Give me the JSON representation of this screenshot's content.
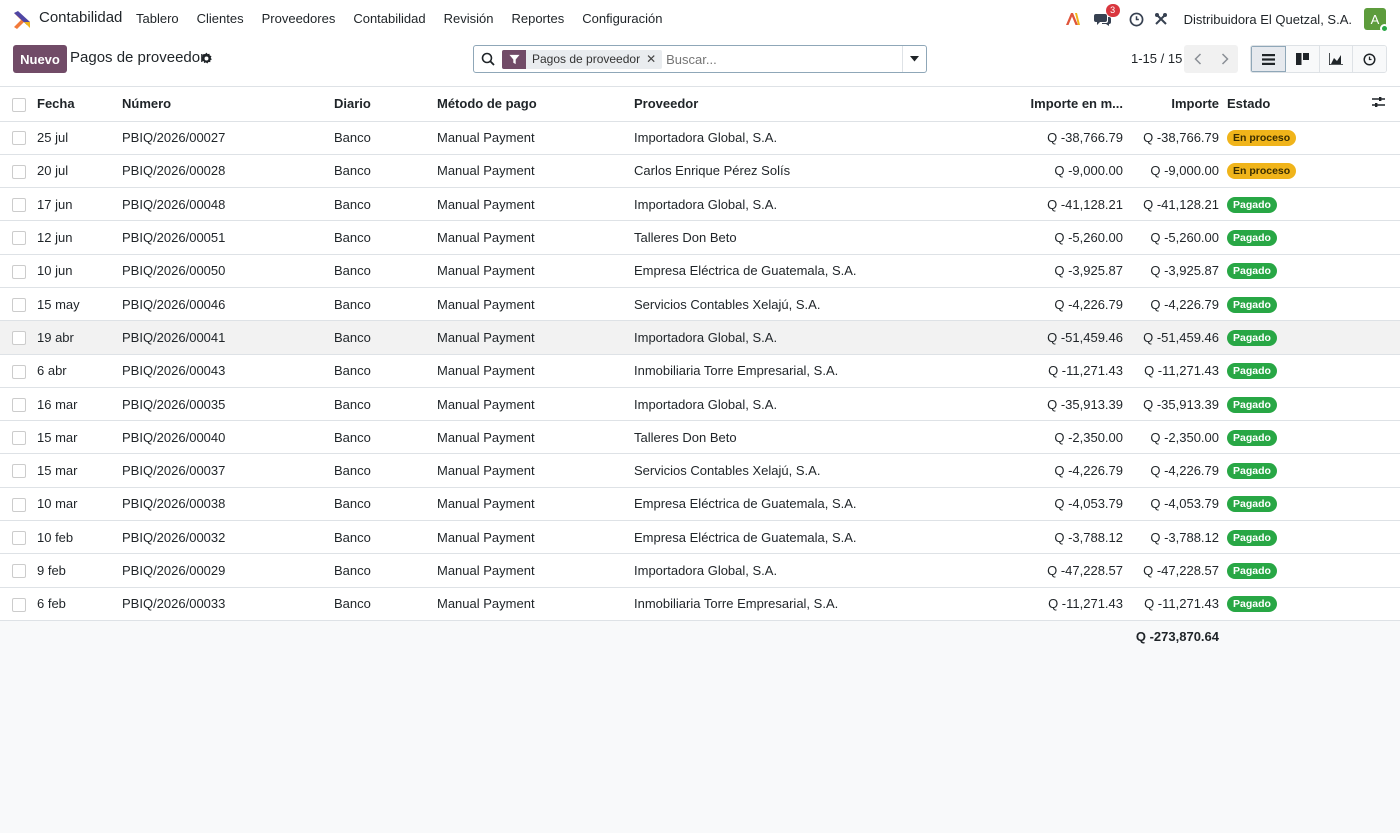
{
  "app": {
    "name": "Contabilidad"
  },
  "menu": [
    {
      "label": "Tablero"
    },
    {
      "label": "Clientes"
    },
    {
      "label": "Proveedores"
    },
    {
      "label": "Contabilidad"
    },
    {
      "label": "Revisión"
    },
    {
      "label": "Reportes"
    },
    {
      "label": "Configuración"
    }
  ],
  "navbar": {
    "messages_count": "3",
    "company": "Distribuidora El Quetzal, S.A.",
    "avatar_letter": "A"
  },
  "control": {
    "new_label": "Nuevo",
    "title": "Pagos de proveedor",
    "facet_label": "Pagos de proveedor",
    "search_placeholder": "Buscar...",
    "pager": "1-15 / 15"
  },
  "table": {
    "headers": {
      "fecha": "Fecha",
      "numero": "Número",
      "diario": "Diario",
      "metodo": "Método de pago",
      "proveedor": "Proveedor",
      "importe_moneda": "Importe en m...",
      "importe": "Importe",
      "estado": "Estado"
    },
    "rows": [
      {
        "fecha": "25 jul",
        "numero": "PBIQ/2026/00027",
        "diario": "Banco",
        "metodo": "Manual Payment",
        "proveedor": "Importadora Global, S.A.",
        "importe_moneda": "Q -38,766.79",
        "importe": "Q -38,766.79",
        "estado": "En proceso"
      },
      {
        "fecha": "20 jul",
        "numero": "PBIQ/2026/00028",
        "diario": "Banco",
        "metodo": "Manual Payment",
        "proveedor": "Carlos Enrique Pérez Solís",
        "importe_moneda": "Q -9,000.00",
        "importe": "Q -9,000.00",
        "estado": "En proceso"
      },
      {
        "fecha": "17 jun",
        "numero": "PBIQ/2026/00048",
        "diario": "Banco",
        "metodo": "Manual Payment",
        "proveedor": "Importadora Global, S.A.",
        "importe_moneda": "Q -41,128.21",
        "importe": "Q -41,128.21",
        "estado": "Pagado"
      },
      {
        "fecha": "12 jun",
        "numero": "PBIQ/2026/00051",
        "diario": "Banco",
        "metodo": "Manual Payment",
        "proveedor": "Talleres Don Beto",
        "importe_moneda": "Q -5,260.00",
        "importe": "Q -5,260.00",
        "estado": "Pagado"
      },
      {
        "fecha": "10 jun",
        "numero": "PBIQ/2026/00050",
        "diario": "Banco",
        "metodo": "Manual Payment",
        "proveedor": "Empresa Eléctrica de Guatemala, S.A.",
        "importe_moneda": "Q -3,925.87",
        "importe": "Q -3,925.87",
        "estado": "Pagado"
      },
      {
        "fecha": "15 may",
        "numero": "PBIQ/2026/00046",
        "diario": "Banco",
        "metodo": "Manual Payment",
        "proveedor": "Servicios Contables Xelajú, S.A.",
        "importe_moneda": "Q -4,226.79",
        "importe": "Q -4,226.79",
        "estado": "Pagado"
      },
      {
        "fecha": "19 abr",
        "numero": "PBIQ/2026/00041",
        "diario": "Banco",
        "metodo": "Manual Payment",
        "proveedor": "Importadora Global, S.A.",
        "importe_moneda": "Q -51,459.46",
        "importe": "Q -51,459.46",
        "estado": "Pagado"
      },
      {
        "fecha": "6 abr",
        "numero": "PBIQ/2026/00043",
        "diario": "Banco",
        "metodo": "Manual Payment",
        "proveedor": "Inmobiliaria Torre Empresarial, S.A.",
        "importe_moneda": "Q -11,271.43",
        "importe": "Q -11,271.43",
        "estado": "Pagado"
      },
      {
        "fecha": "16 mar",
        "numero": "PBIQ/2026/00035",
        "diario": "Banco",
        "metodo": "Manual Payment",
        "proveedor": "Importadora Global, S.A.",
        "importe_moneda": "Q -35,913.39",
        "importe": "Q -35,913.39",
        "estado": "Pagado"
      },
      {
        "fecha": "15 mar",
        "numero": "PBIQ/2026/00040",
        "diario": "Banco",
        "metodo": "Manual Payment",
        "proveedor": "Talleres Don Beto",
        "importe_moneda": "Q -2,350.00",
        "importe": "Q -2,350.00",
        "estado": "Pagado"
      },
      {
        "fecha": "15 mar",
        "numero": "PBIQ/2026/00037",
        "diario": "Banco",
        "metodo": "Manual Payment",
        "proveedor": "Servicios Contables Xelajú, S.A.",
        "importe_moneda": "Q -4,226.79",
        "importe": "Q -4,226.79",
        "estado": "Pagado"
      },
      {
        "fecha": "10 mar",
        "numero": "PBIQ/2026/00038",
        "diario": "Banco",
        "metodo": "Manual Payment",
        "proveedor": "Empresa Eléctrica de Guatemala, S.A.",
        "importe_moneda": "Q -4,053.79",
        "importe": "Q -4,053.79",
        "estado": "Pagado"
      },
      {
        "fecha": "10 feb",
        "numero": "PBIQ/2026/00032",
        "diario": "Banco",
        "metodo": "Manual Payment",
        "proveedor": "Empresa Eléctrica de Guatemala, S.A.",
        "importe_moneda": "Q -3,788.12",
        "importe": "Q -3,788.12",
        "estado": "Pagado"
      },
      {
        "fecha": "9 feb",
        "numero": "PBIQ/2026/00029",
        "diario": "Banco",
        "metodo": "Manual Payment",
        "proveedor": "Importadora Global, S.A.",
        "importe_moneda": "Q -47,228.57",
        "importe": "Q -47,228.57",
        "estado": "Pagado"
      },
      {
        "fecha": "6 feb",
        "numero": "PBIQ/2026/00033",
        "diario": "Banco",
        "metodo": "Manual Payment",
        "proveedor": "Inmobiliaria Torre Empresarial, S.A.",
        "importe_moneda": "Q -11,271.43",
        "importe": "Q -11,271.43",
        "estado": "Pagado"
      }
    ],
    "total": "Q -273,870.64"
  },
  "colors": {
    "brand": "#714b67",
    "status_in_process": "#f0b41a",
    "status_paid": "#28a745"
  },
  "icons": [
    "app-logo-icon",
    "ai-icon",
    "chat-icon",
    "clock-icon",
    "tools-icon",
    "gear-icon",
    "search-icon",
    "filter-icon",
    "close-icon",
    "caret-down-icon",
    "chevron-left-icon",
    "chevron-right-icon",
    "list-view-icon",
    "kanban-view-icon",
    "graph-view-icon",
    "activity-view-icon",
    "optional-columns-icon"
  ]
}
